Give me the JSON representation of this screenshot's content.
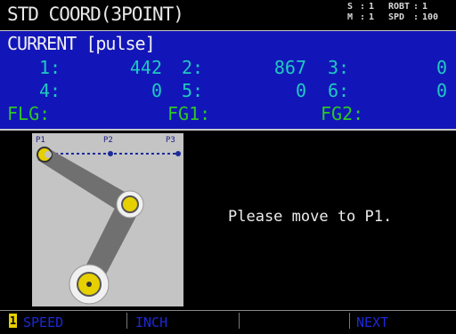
{
  "title": "STD COORD(3POINT)",
  "status": {
    "line1": {
      "key": "S",
      "sep": ":",
      "val": "1",
      "key2": "ROBT",
      "sep2": ":",
      "val2": "1"
    },
    "line2": {
      "key": "M",
      "sep": ":",
      "val": "1",
      "key2": "SPD",
      "sep2": ":",
      "val2": "100"
    }
  },
  "current": {
    "label": "CURRENT [pulse]",
    "axes": [
      {
        "label": "1:",
        "value": "442"
      },
      {
        "label": "2:",
        "value": "867"
      },
      {
        "label": "3:",
        "value": "0"
      },
      {
        "label": "4:",
        "value": "0"
      },
      {
        "label": "5:",
        "value": "0"
      },
      {
        "label": "6:",
        "value": "0"
      }
    ],
    "flags": {
      "flg": "FLG:",
      "fg1": "FG1:",
      "fg2": "FG2:"
    }
  },
  "diagram": {
    "p1": "P1",
    "p2": "P2",
    "p3": "P3"
  },
  "message": "Please move to P1.",
  "fkeys": {
    "number": "1",
    "f1": "SPEED",
    "f2": "INCH",
    "f3": "",
    "f4": "NEXT"
  },
  "colors": {
    "panel": "#1216b8",
    "values": "#1fc9c0",
    "flags": "#2ec820",
    "arm": "#707070",
    "joint": "#e6d000",
    "fkey_text": "#1d28d8"
  }
}
